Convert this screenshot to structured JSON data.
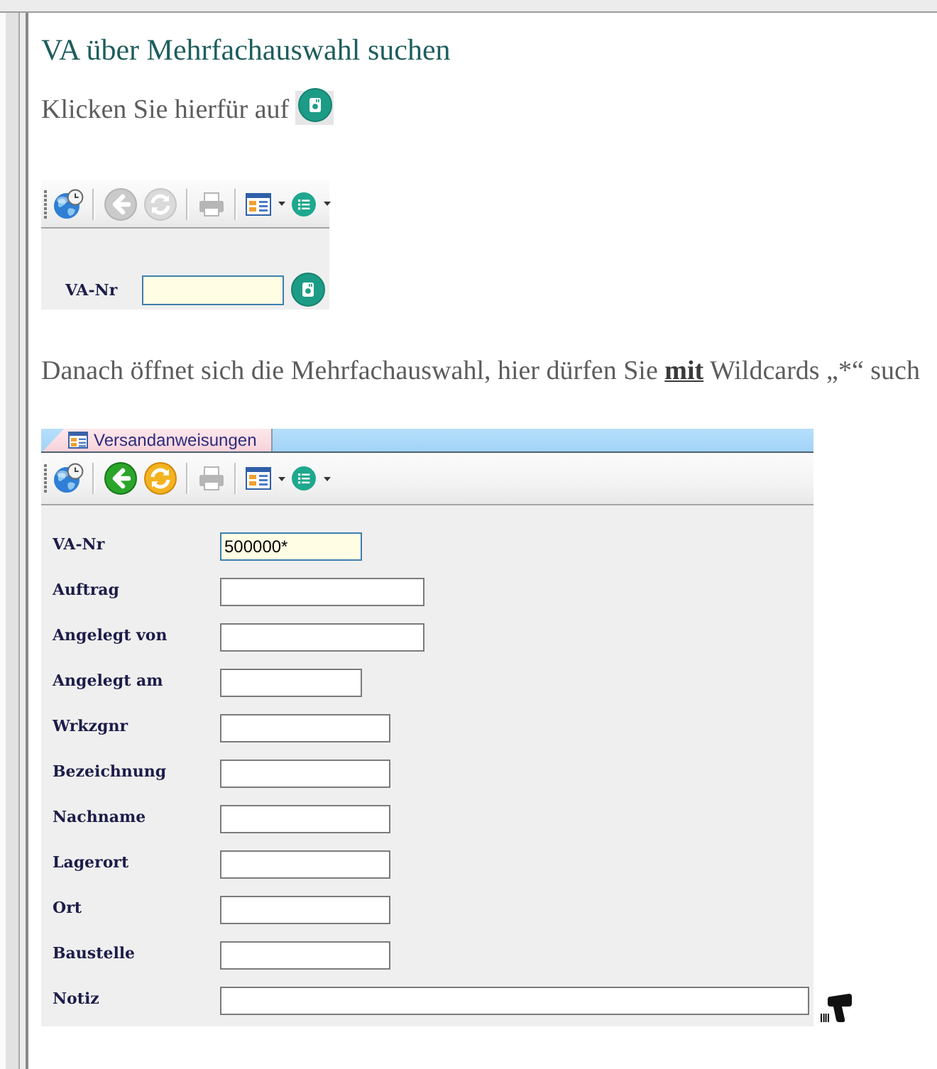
{
  "title": "VA über Mehrfachauswahl suchen",
  "intro": "Klicken Sie hierfür auf",
  "search_form": {
    "toolbar": [
      [
        {
          "kind": "globe",
          "disabled": false,
          "dropdown": false
        }
      ],
      [
        {
          "kind": "back",
          "disabled": true,
          "dropdown": false
        },
        {
          "kind": "refresh",
          "disabled": true,
          "dropdown": false
        }
      ],
      [
        {
          "kind": "print",
          "disabled": true,
          "dropdown": false
        }
      ],
      [
        {
          "kind": "window",
          "disabled": false,
          "dropdown": true
        },
        {
          "kind": "list",
          "disabled": false,
          "dropdown": true
        }
      ]
    ],
    "fields": [
      {
        "label": "VA-Nr",
        "highlighted": true
      }
    ]
  },
  "instruction": "Danach öffnet sich die Mehrfachauswahl, hier dürfen Sie **mit** Wildcards „*“ such",
  "selection_dialog": {
    "tabs": [
      {
        "label": "Versandanweisungen",
        "selected": true
      }
    ],
    "toolbar": [
      [
        {
          "kind": "globe",
          "disabled": false,
          "dropdown": false
        }
      ],
      [
        {
          "kind": "back",
          "disabled": false,
          "dropdown": false
        },
        {
          "kind": "refresh",
          "disabled": false,
          "dropdown": false
        }
      ],
      [
        {
          "kind": "print",
          "disabled": true,
          "dropdown": false
        }
      ],
      [
        {
          "kind": "window",
          "disabled": false,
          "dropdown": true
        },
        {
          "kind": "list",
          "disabled": false,
          "dropdown": true
        }
      ]
    ],
    "fields": [
      {
        "label": "VA-Nr",
        "value": "500000*",
        "highlighted": true
      },
      {
        "label": "Auftrag",
        "highlighted": false
      },
      {
        "label": "Angelegt von",
        "highlighted": false
      },
      {
        "label": "Angelegt am",
        "highlighted": false
      },
      {
        "label": "Wrkzgnr",
        "highlighted": false
      },
      {
        "label": "Bezeichnung",
        "highlighted": false
      },
      {
        "label": "Nachname",
        "highlighted": false
      },
      {
        "label": "Lagerort",
        "highlighted": false
      },
      {
        "label": "Ort",
        "highlighted": false
      },
      {
        "label": "Baustelle",
        "highlighted": false
      },
      {
        "label": "Notiz",
        "highlighted": false
      }
    ]
  }
}
